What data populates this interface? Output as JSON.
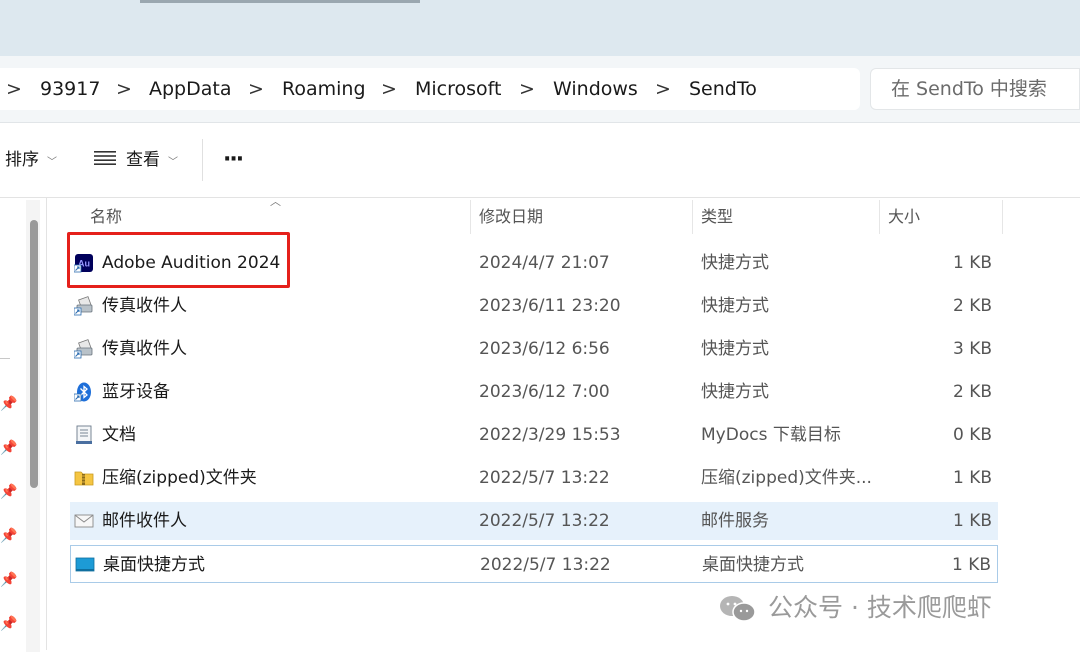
{
  "breadcrumb": [
    "93917",
    "AppData",
    "Roaming",
    "Microsoft",
    "Windows",
    "SendTo"
  ],
  "breadcrumb_separator": ">",
  "search": {
    "placeholder": "在 SendTo 中搜索"
  },
  "toolbar": {
    "sort_label": "排序",
    "view_label": "查看",
    "more_label": "···"
  },
  "columns": {
    "name": "名称",
    "date": "修改日期",
    "type": "类型",
    "size": "大小"
  },
  "files": [
    {
      "name": "Adobe Audition 2024",
      "date": "2024/4/7 21:07",
      "type": "快捷方式",
      "size": "1 KB",
      "icon": "adobe-audition-icon"
    },
    {
      "name": "传真收件人",
      "date": "2023/6/11 23:20",
      "type": "快捷方式",
      "size": "2 KB",
      "icon": "fax-icon"
    },
    {
      "name": "传真收件人",
      "date": "2023/6/12 6:56",
      "type": "快捷方式",
      "size": "3 KB",
      "icon": "fax-icon"
    },
    {
      "name": "蓝牙设备",
      "date": "2023/6/12 7:00",
      "type": "快捷方式",
      "size": "2 KB",
      "icon": "bluetooth-icon"
    },
    {
      "name": "文档",
      "date": "2022/3/29 15:53",
      "type": "MyDocs 下载目标",
      "size": "0 KB",
      "icon": "documents-icon"
    },
    {
      "name": "压缩(zipped)文件夹",
      "date": "2022/5/7 13:22",
      "type": "压缩(zipped)文件夹...",
      "size": "1 KB",
      "icon": "zip-folder-icon"
    },
    {
      "name": "邮件收件人",
      "date": "2022/5/7 13:22",
      "type": "邮件服务",
      "size": "1 KB",
      "icon": "mail-icon"
    },
    {
      "name": "桌面快捷方式",
      "date": "2022/5/7 13:22",
      "type": "桌面快捷方式",
      "size": "1 KB",
      "icon": "desktop-icon"
    }
  ],
  "watermark": {
    "text": "公众号 · 技术爬爬虾"
  },
  "colors": {
    "highlight_box": "#e5201b",
    "hover_row": "#e6f1fb",
    "selected_border": "#a9cbe8"
  }
}
